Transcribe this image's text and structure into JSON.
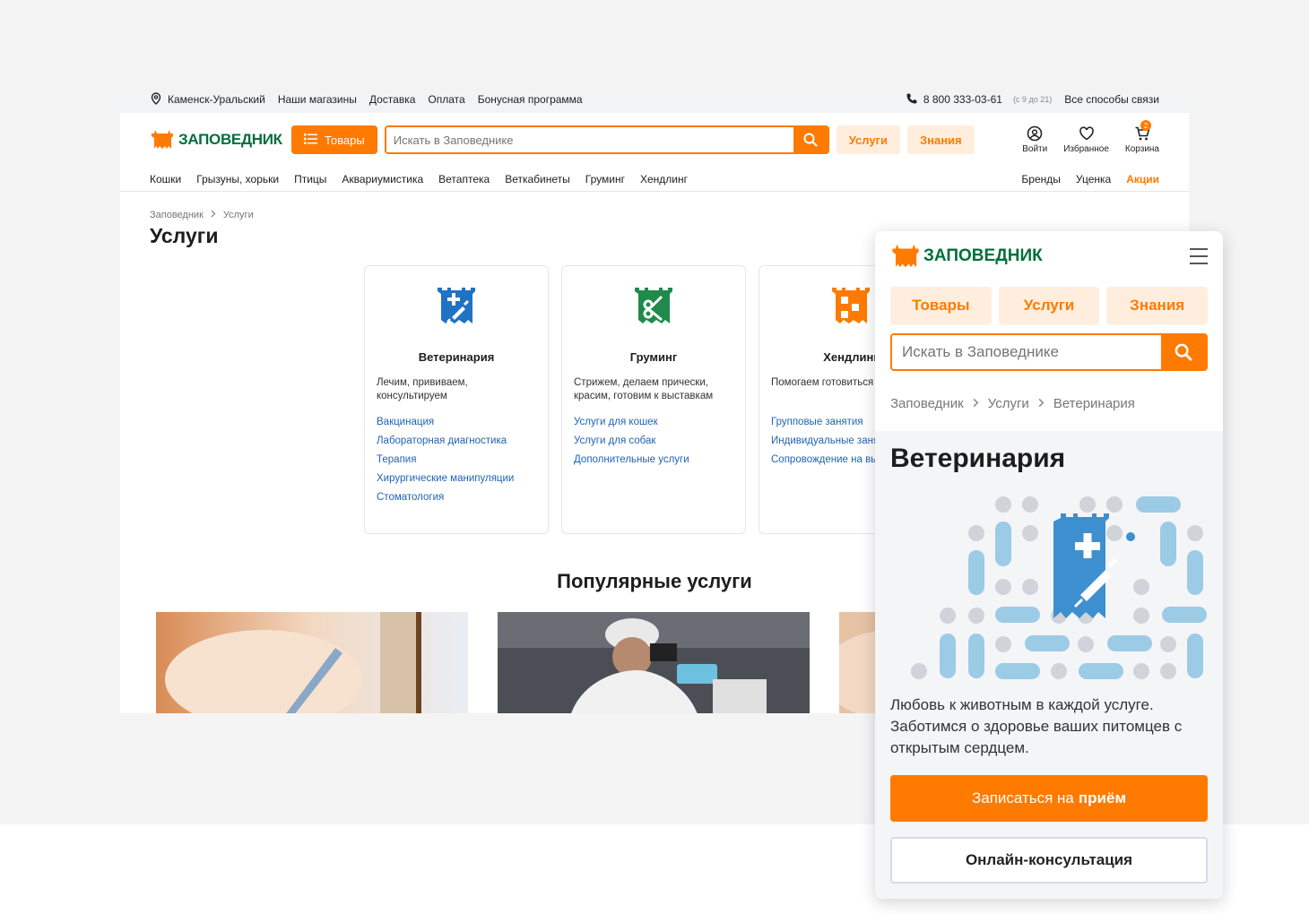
{
  "topbar": {
    "city": "Каменск-Уральский",
    "links": [
      "Наши магазины",
      "Доставка",
      "Оплата",
      "Бонусная программа"
    ],
    "phone": "8 800 333-03-61",
    "phone_hours": "(с 9 до 21)",
    "contacts": "Все способы связи"
  },
  "header": {
    "logo": "ЗАПОВЕДНИК",
    "catalog_button": "Товары",
    "search_placeholder": "Искать в Заповеднике",
    "services": "Услуги",
    "knowledge": "Знания",
    "login": "Войти",
    "favorites": "Избранное",
    "cart": "Корзина",
    "cart_count": "2"
  },
  "nav": {
    "left": [
      "Кошки",
      "Грызуны, хорьки",
      "Птицы",
      "Аквариумистика",
      "Ветаптека",
      "Веткабинеты",
      "Груминг",
      "Хендлинг"
    ],
    "right": [
      "Бренды",
      "Уценка",
      "Акции"
    ]
  },
  "breadcrumbs": [
    "Заповедник",
    "Услуги"
  ],
  "page_title": "Услуги",
  "cards": [
    {
      "title": "Ветеринария",
      "desc": "Лечим, прививаем, консультируем",
      "links": [
        "Вакцинация",
        "Лабораторная диагностика",
        "Терапия",
        "Хирургические манипуляции",
        "Стоматология"
      ]
    },
    {
      "title": "Груминг",
      "desc": "Стрижем, делаем прически, красим, готовим к выставкам",
      "links": [
        "Услуги для кошек",
        "Услуги для собак",
        "Дополнительные услуги"
      ]
    },
    {
      "title": "Хендлинг",
      "desc": "Помогаем готовиться к выставке",
      "links": [
        "Групповые занятия",
        "Индивидуальные занятия",
        "Сопровождение на выставке"
      ]
    }
  ],
  "popular_title": "Популярные услуги",
  "mobile": {
    "logo": "ЗАПОВЕДНИК",
    "pills": [
      "Товары",
      "Услуги",
      "Знания"
    ],
    "search_placeholder": "Искать в Заповеднике",
    "breadcrumbs": [
      "Заповедник",
      "Услуги",
      "Ветеринария"
    ],
    "title": "Ветеринария",
    "text": "Любовь к животным в каждой услуге. Заботимся о здоровье ваших питомцев с открытым сердцем.",
    "primary_button": "Записаться на",
    "primary_button_bold": "приём",
    "secondary_button": "Онлайн-консультация"
  },
  "colors": {
    "accent": "#ff7a00",
    "accent_light": "#ffeedd",
    "brand_green": "#006f3c",
    "link": "#1f63b5",
    "vet_blue": "#1f72c4",
    "groom_green": "#1f8a4c",
    "illustration_blue": "#9ccbe6"
  }
}
